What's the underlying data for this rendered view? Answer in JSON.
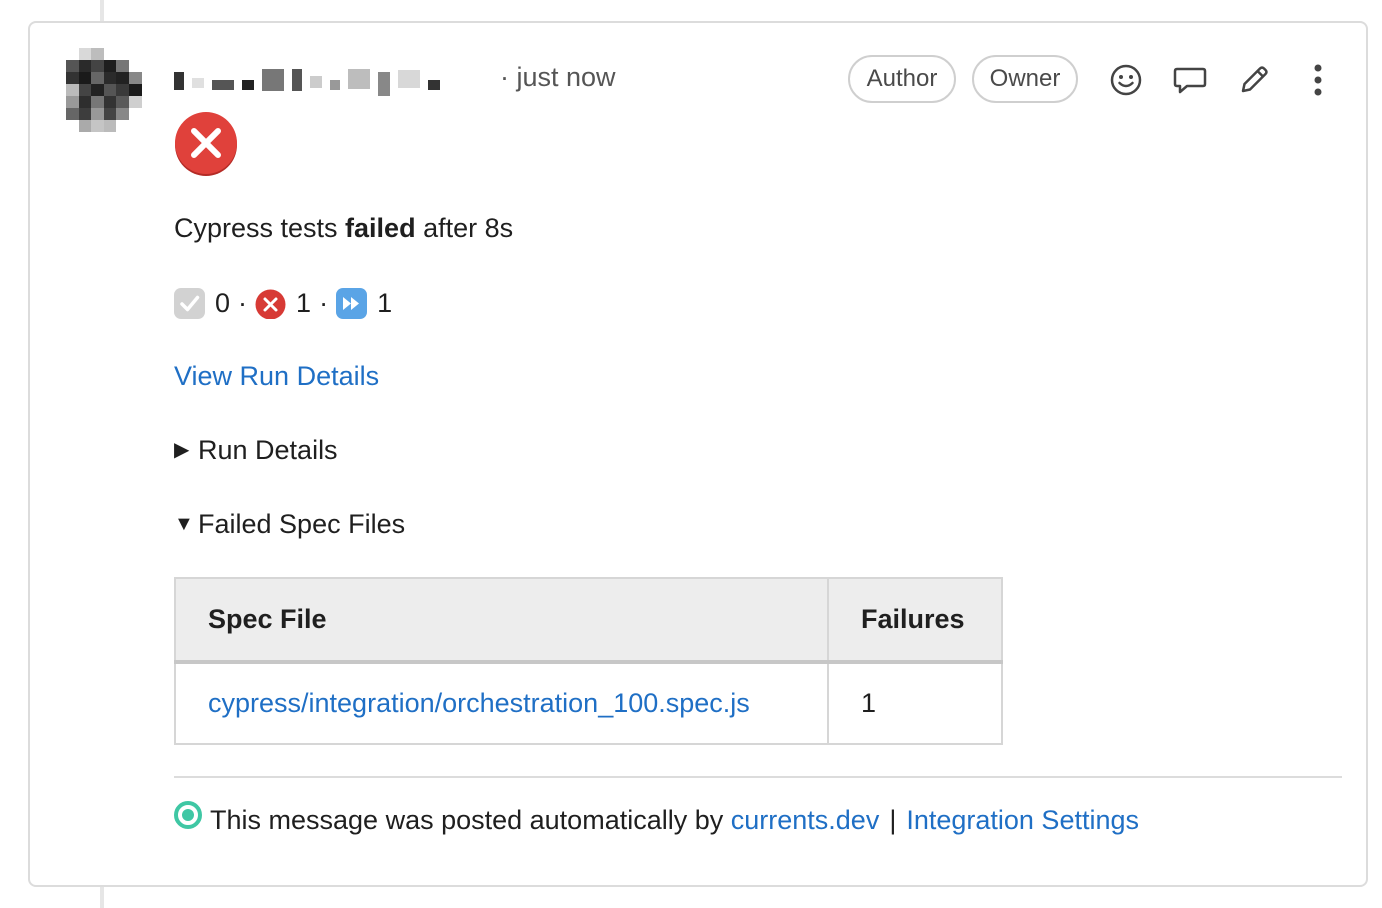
{
  "header": {
    "time": "· just now",
    "badges": {
      "author": "Author",
      "owner": "Owner"
    },
    "icons": [
      "smiley-icon",
      "comment-icon",
      "pencil-icon",
      "kebab-menu-icon"
    ]
  },
  "status": {
    "icon": "failed-x-icon",
    "color": "#d73a35"
  },
  "summary": {
    "prefix": "Cypress tests ",
    "bold": "failed",
    "suffix": " after 8s"
  },
  "counts": {
    "passed": "0",
    "failed": "1",
    "skipped": "1",
    "sep": "·",
    "colors": {
      "passed": "#cfcfcf",
      "failed": "#d73a35",
      "skipped": "#5aa4e6"
    }
  },
  "view_run_link": "View Run Details",
  "sections": {
    "run_details": {
      "label": "Run Details",
      "expanded": false
    },
    "failed_specs": {
      "label": "Failed Spec Files",
      "expanded": true
    }
  },
  "table": {
    "headers": [
      "Spec File",
      "Failures"
    ],
    "rows": [
      {
        "spec": "cypress/integration/orchestration_100.spec.js",
        "failures": "1"
      }
    ]
  },
  "footer": {
    "text": "This message was posted automatically by ",
    "link1": "currents.dev",
    "sep": "|",
    "link2": "Integration Settings",
    "dot_color": "#3fc7a4"
  }
}
